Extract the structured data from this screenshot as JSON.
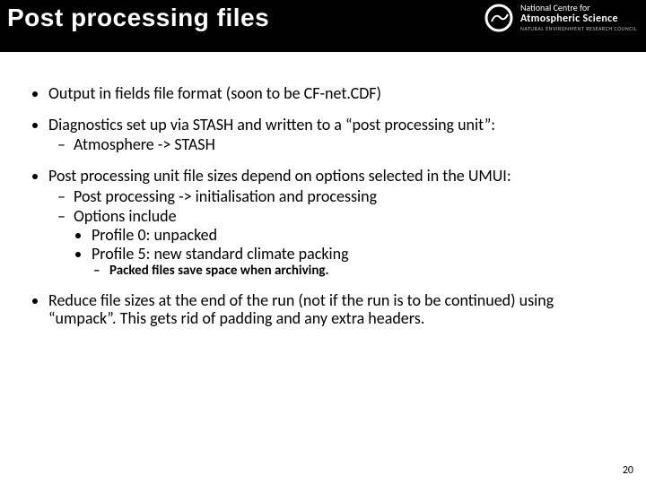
{
  "header": {
    "title": "Post processing files",
    "logo": {
      "top": "National Centre for",
      "main": "Atmospheric Science",
      "sub": "NATURAL ENVIRONMENT RESEARCH COUNCIL"
    }
  },
  "bullets": {
    "b1": "Output in fields file format (soon to be CF-net.CDF)",
    "b2": "Diagnostics set up via STASH and written to a “post processing unit”:",
    "b2a": "Atmosphere -> STASH",
    "b3": "Post processing unit file sizes depend on options selected in the UMUI:",
    "b3a": "Post processing -> initialisation and processing",
    "b3b": "Options include",
    "b3b1": "Profile 0: unpacked",
    "b3b2": "Profile 5: new standard climate packing",
    "b3b2a": "Packed files save space when archiving.",
    "b4": "Reduce file sizes at the end of the run (not if the run is to be continued) using “umpack”.  This gets rid of padding and any extra headers."
  },
  "page_number": "20"
}
